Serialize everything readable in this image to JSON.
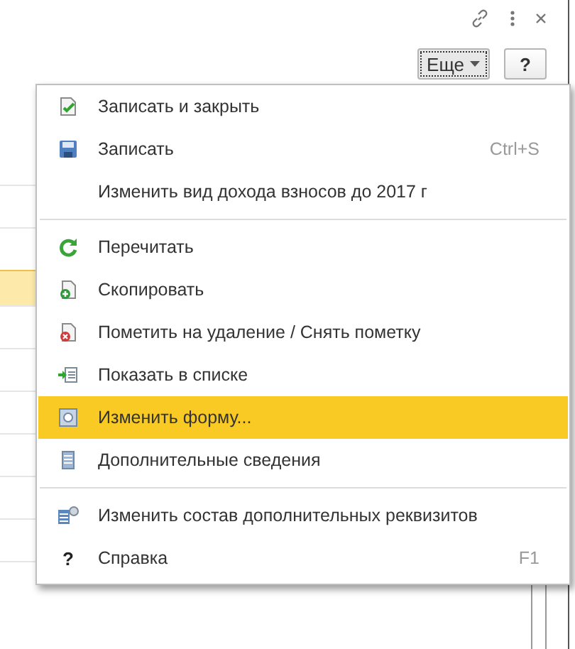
{
  "toolbar": {
    "more_button": {
      "label": "Еще",
      "expanded": true
    },
    "help_button": {
      "label": "?"
    }
  },
  "menu": {
    "items": [
      {
        "kind": "item",
        "label": "Записать и закрыть",
        "selected": false
      },
      {
        "kind": "item",
        "label": "Записать",
        "shortcut": "Ctrl+S",
        "selected": false
      },
      {
        "kind": "item",
        "label": "Изменить вид дохода взносов до 2017 г",
        "selected": false
      },
      {
        "kind": "separator"
      },
      {
        "kind": "item",
        "label": "Перечитать",
        "selected": false
      },
      {
        "kind": "item",
        "label": "Скопировать",
        "selected": false
      },
      {
        "kind": "item",
        "label": "Пометить на удаление / Снять пометку",
        "selected": false
      },
      {
        "kind": "item",
        "label": "Показать в списке",
        "selected": false
      },
      {
        "kind": "item",
        "label": "Изменить форму...",
        "selected": true
      },
      {
        "kind": "item",
        "label": "Дополнительные сведения",
        "selected": false
      },
      {
        "kind": "separator"
      },
      {
        "kind": "item",
        "label": "Изменить состав дополнительных реквизитов",
        "selected": false
      },
      {
        "kind": "item",
        "glyph": "?",
        "label": "Справка",
        "shortcut": "F1",
        "selected": false
      }
    ]
  }
}
